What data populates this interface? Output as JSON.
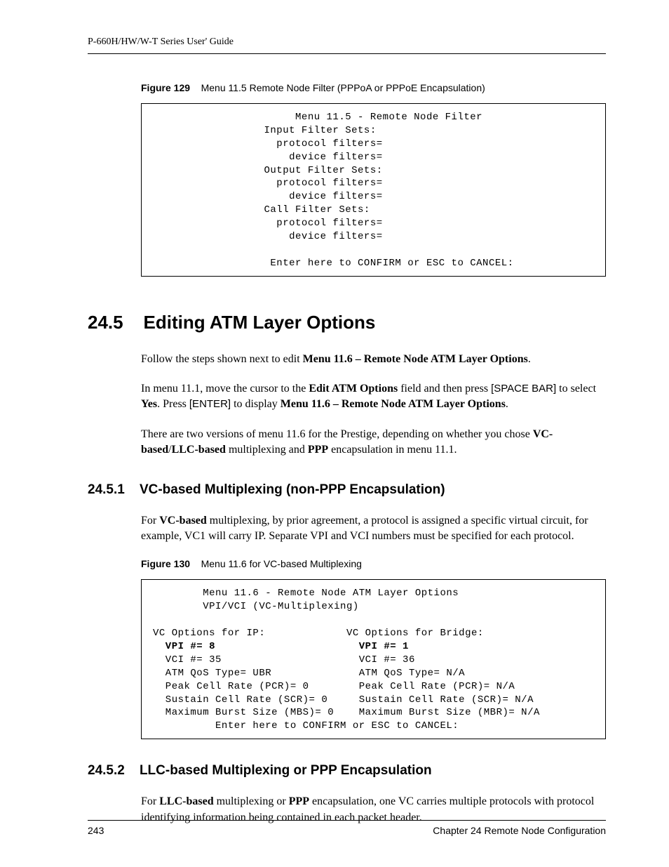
{
  "header": {
    "guide_title": "P-660H/HW/W-T Series User' Guide"
  },
  "figure129": {
    "label": "Figure 129",
    "caption": "Menu 11.5 Remote Node Filter (PPPoA or PPPoE Encapsulation)",
    "terminal": "          Menu 11.5 - Remote Node Filter\n     Input Filter Sets:\n       protocol filters=\n         device filters=\n     Output Filter Sets:\n       protocol filters=\n         device filters=\n     Call Filter Sets:\n       protocol filters=\n         device filters=\n\n      Enter here to CONFIRM or ESC to CANCEL:"
  },
  "section_24_5": {
    "number": "24.5",
    "title": "Editing ATM Layer Options",
    "para1_parts": {
      "t1": "Follow the steps shown next to edit ",
      "b1": "Menu 11.6 – Remote Node ATM Layer Options",
      "t2": "."
    },
    "para2_parts": {
      "t1": "In menu 11.1, move the cursor to the ",
      "b1": "Edit ATM Options",
      "t2": " field and then press ",
      "s1": "[SPACE BAR]",
      "t3": " to select ",
      "b2": "Yes",
      "t4": ". Press ",
      "s2": "[ENTER]",
      "t5": " to display ",
      "b3": "Menu 11.6 – Remote Node ATM Layer Options",
      "t6": "."
    },
    "para3_parts": {
      "t1": "There are two versions of menu 11.6 for the Prestige, depending on whether you chose ",
      "b1": "VC-based",
      "t2": "/",
      "b2": "LLC-based",
      "t3": " multiplexing and ",
      "b3": "PPP",
      "t4": " encapsulation in menu 11.1."
    }
  },
  "section_24_5_1": {
    "number": "24.5.1",
    "title": "VC-based Multiplexing (non-PPP Encapsulation)",
    "para1_parts": {
      "t1": "For ",
      "b1": "VC-based",
      "t2": " multiplexing, by prior agreement, a protocol is assigned a specific virtual circuit, for example, VC1 will carry IP. Separate VPI and VCI numbers must be specified for each protocol."
    }
  },
  "figure130": {
    "label": "Figure 130",
    "caption": "Menu 11.6 for VC-based Multiplexing",
    "terminal_pre": "        Menu 11.6 - Remote Node ATM Layer Options\n        VPI/VCI (VC-Multiplexing)\n\nVC Options for IP:             VC Options for Bridge:",
    "terminal_bold": "  VPI #= 8                       VPI #= 1",
    "terminal_post": "  VCI #= 35                      VCI #= 36\n  ATM QoS Type= UBR              ATM QoS Type= N/A\n  Peak Cell Rate (PCR)= 0        Peak Cell Rate (PCR)= N/A\n  Sustain Cell Rate (SCR)= 0     Sustain Cell Rate (SCR)= N/A\n  Maximum Burst Size (MBS)= 0    Maximum Burst Size (MBR)= N/A\n          Enter here to CONFIRM or ESC to CANCEL:"
  },
  "section_24_5_2": {
    "number": "24.5.2",
    "title": "LLC-based Multiplexing or PPP Encapsulation",
    "para1_parts": {
      "t1": "For ",
      "b1": "LLC-based",
      "t2": " multiplexing or ",
      "b2": "PPP",
      "t3": " encapsulation, one VC carries multiple protocols with protocol identifying information being contained in each packet header."
    }
  },
  "footer": {
    "page_number": "243",
    "chapter": "Chapter 24 Remote Node Configuration"
  }
}
